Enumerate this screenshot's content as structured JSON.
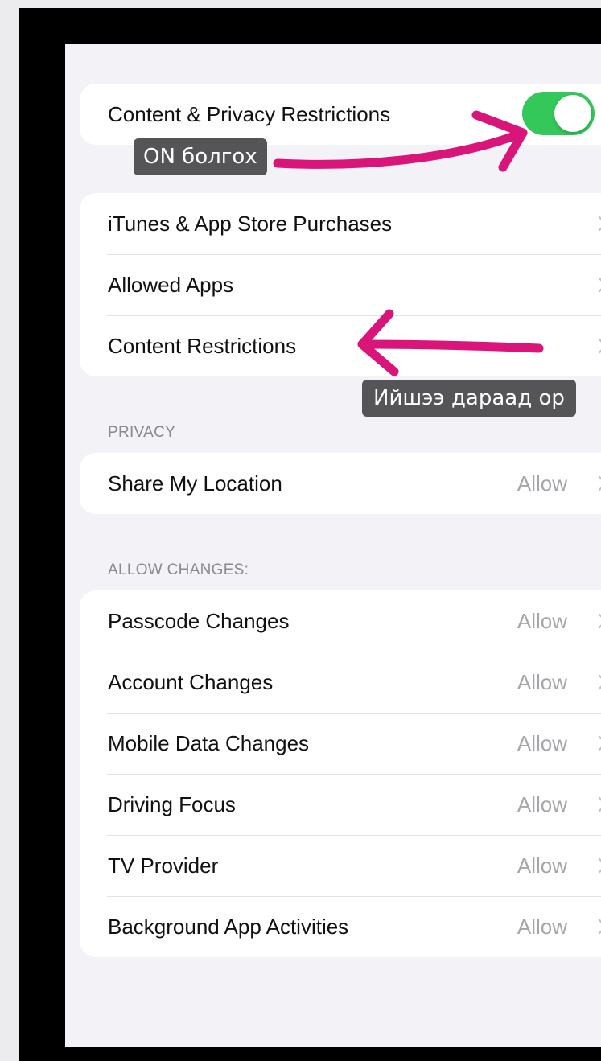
{
  "restrictions_toggle": {
    "label": "Content & Privacy Restrictions",
    "state": "on"
  },
  "main_items": [
    {
      "label": "iTunes & App Store Purchases"
    },
    {
      "label": "Allowed Apps"
    },
    {
      "label": "Content Restrictions"
    }
  ],
  "privacy": {
    "header": "PRIVACY",
    "items": [
      {
        "label": "Share My Location",
        "value": "Allow"
      }
    ]
  },
  "allow_changes": {
    "header": "ALLOW CHANGES:",
    "items": [
      {
        "label": "Passcode Changes",
        "value": "Allow"
      },
      {
        "label": "Account Changes",
        "value": "Allow"
      },
      {
        "label": "Mobile Data Changes",
        "value": "Allow"
      },
      {
        "label": "Driving Focus",
        "value": "Allow"
      },
      {
        "label": "TV Provider",
        "value": "Allow"
      },
      {
        "label": "Background App Activities",
        "value": "Allow"
      }
    ]
  },
  "annotations": {
    "toggle_note": "ON болгох",
    "content_restrictions_note": "Ийшээ дараад ор"
  },
  "colors": {
    "toggle_on": "#34c759",
    "arrow": "#d9157a",
    "annotation_bg": "#555558",
    "secondary_text": "#a5a5aa"
  }
}
